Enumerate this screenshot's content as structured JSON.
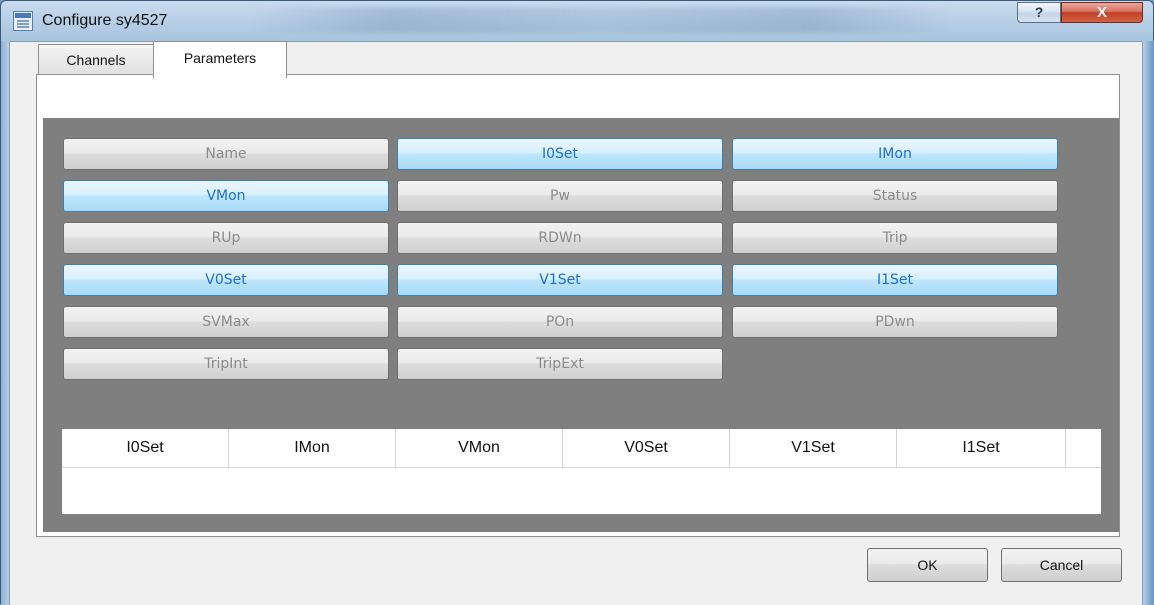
{
  "window": {
    "title": "Configure sy4527",
    "help_label": "?",
    "close_label": "X"
  },
  "tabs": [
    {
      "label": "Channels",
      "active": false
    },
    {
      "label": "Parameters",
      "active": true
    }
  ],
  "parameters": {
    "buttons": [
      {
        "label": "Name",
        "selected": false
      },
      {
        "label": "I0Set",
        "selected": true
      },
      {
        "label": "IMon",
        "selected": true
      },
      {
        "label": "VMon",
        "selected": true
      },
      {
        "label": "Pw",
        "selected": false
      },
      {
        "label": "Status",
        "selected": false
      },
      {
        "label": "RUp",
        "selected": false
      },
      {
        "label": "RDWn",
        "selected": false
      },
      {
        "label": "Trip",
        "selected": false
      },
      {
        "label": "V0Set",
        "selected": true
      },
      {
        "label": "V1Set",
        "selected": true
      },
      {
        "label": "I1Set",
        "selected": true
      },
      {
        "label": "SVMax",
        "selected": false
      },
      {
        "label": "POn",
        "selected": false
      },
      {
        "label": "PDwn",
        "selected": false
      },
      {
        "label": "TripInt",
        "selected": false
      },
      {
        "label": "TripExt",
        "selected": false
      }
    ]
  },
  "table": {
    "columns": [
      "I0Set",
      "IMon",
      "VMon",
      "V0Set",
      "V1Set",
      "I1Set"
    ]
  },
  "footer": {
    "ok_label": "OK",
    "cancel_label": "Cancel"
  },
  "colors": {
    "selected_text": "#1e6fd0",
    "unselected_text": "#8a8a8a",
    "pane_background": "#7f7f7f"
  }
}
